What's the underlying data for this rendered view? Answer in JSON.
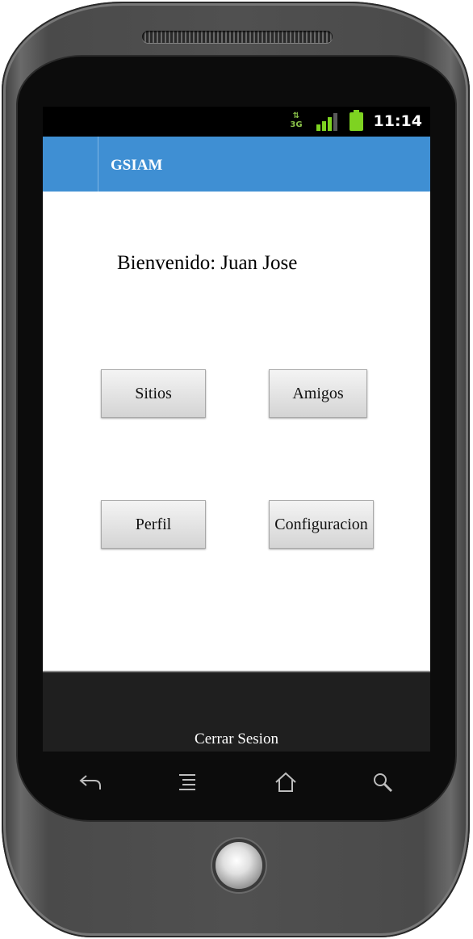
{
  "status_bar": {
    "time": "11:14",
    "network_label": "3G",
    "icons": [
      "data-3g-icon",
      "signal-icon",
      "battery-icon"
    ],
    "battery_color": "#7ed321"
  },
  "action_bar": {
    "title": "GSIAM",
    "color": "#3f8fd3"
  },
  "main": {
    "welcome_label": "Bienvenido:",
    "user_name": "Juan Jose",
    "buttons": {
      "sitios": "Sitios",
      "amigos": "Amigos",
      "perfil": "Perfil",
      "configuracion": "Configuracion"
    }
  },
  "footer": {
    "logout_label": "Cerrar Sesion"
  },
  "device_keys": [
    "back-icon",
    "menu-icon",
    "home-icon",
    "search-icon"
  ]
}
